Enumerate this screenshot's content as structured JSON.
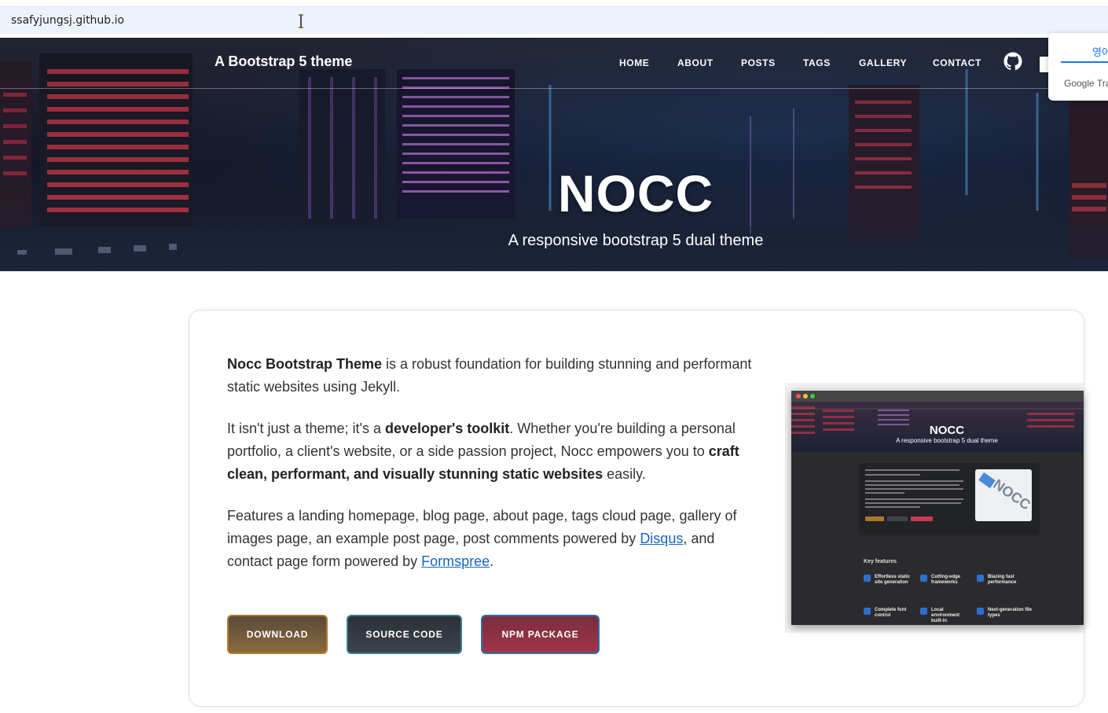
{
  "browser": {
    "url": "ssafyjungsj.github.io"
  },
  "navbar": {
    "brand": "A Bootstrap 5 theme",
    "items": [
      "HOME",
      "ABOUT",
      "POSTS",
      "TAGS",
      "GALLERY",
      "CONTACT"
    ]
  },
  "hero": {
    "title": "NOCC",
    "subtitle": "A responsive bootstrap 5 dual theme"
  },
  "translate": {
    "tab": "영어",
    "label": "Google Tra"
  },
  "intro": {
    "p1_bold": "Nocc Bootstrap Theme",
    "p1_rest": " is a robust foundation for building stunning and performant static websites using Jekyll.",
    "p2_a": "It isn't just a theme; it's a ",
    "p2_bold1": "developer's toolkit",
    "p2_b": ". Whether you're building a personal portfolio, a client's website, or a side passion project, Nocc empowers you to ",
    "p2_bold2": "craft clean, performant, and visually stunning static websites",
    "p2_c": " easily.",
    "p3_a": "Features a landing homepage, blog page, about page, tags cloud page, gallery of images page, an example post page, post comments powered by ",
    "p3_link1": "Disqus",
    "p3_b": ", and contact page form powered by ",
    "p3_link2": "Formspree",
    "p3_c": "."
  },
  "buttons": {
    "download": "DOWNLOAD",
    "source": "SOURCE CODE",
    "npm": "NPM PACKAGE"
  },
  "preview": {
    "title": "NOCC",
    "subtitle": "A responsive bootstrap 5 dual theme",
    "logo": "NOCC",
    "key_features": "Key features",
    "features": [
      "Effortless static site generation",
      "Cutting-edge frameworks",
      "Blazing fast performance",
      "Complete font control",
      "Local environment built-in",
      "Next-generation file types"
    ]
  },
  "colors": {
    "btn_download": "#8a6a3a",
    "btn_source": "#3c434c",
    "btn_npm": "#a0344a",
    "link": "#1565c0"
  }
}
